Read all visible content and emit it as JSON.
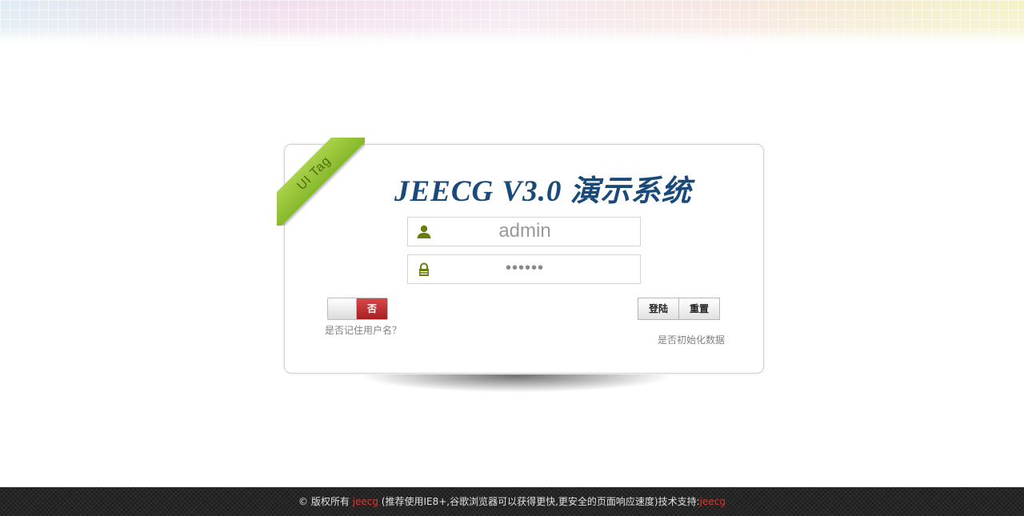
{
  "ribbon": {
    "label": "UI Tag"
  },
  "header": {
    "title": "JEECG  V3.0 演示系统"
  },
  "form": {
    "username_value": "admin",
    "password_value": "••••••",
    "remember_toggle_state": "否",
    "remember_label": "是否记住用户名？",
    "login_label": "登陆",
    "reset_label": "重置",
    "init_data_label": "是否初始化数据"
  },
  "footer": {
    "copyright": "© 版权所有 ",
    "brand_1": "jeecg",
    "notice": " (推荐使用IE8+,谷歌浏览器可以获得更快,更安全的页面响应速度)技术支持:",
    "brand_2": "jeecg"
  },
  "icons": {
    "username": "user-icon",
    "password": "lock-icon"
  },
  "colors": {
    "title": "#1a4a7a",
    "ribbon": "#96c43a",
    "toggle_off": "#c0292c",
    "footer_bg": "#262626",
    "footer_brand": "#d8362f",
    "icon": "#6b7d0a"
  }
}
